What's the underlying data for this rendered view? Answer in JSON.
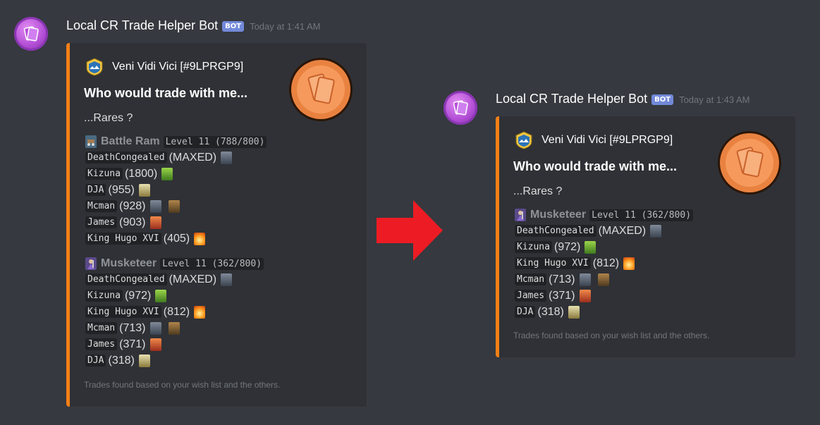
{
  "left": {
    "username": "Local CR Trade Helper Bot",
    "badge": "BOT",
    "timestamp": "Today at 1:41 AM",
    "embed": {
      "author": "Veni Vidi Vici [#9LPRGP9]",
      "title": "Who would trade with me...",
      "description": "...Rares ?",
      "fields": [
        {
          "card": "Battle Ram",
          "level": "Level 11 (788/800)",
          "rows": [
            {
              "player": "DeathCongealed",
              "count": "(MAXED)",
              "icons": [
                "knight-icon"
              ]
            },
            {
              "player": "Kizuna",
              "count": "(1800)",
              "icons": [
                "goblin-icon"
              ]
            },
            {
              "player": "DJA",
              "count": "(955)",
              "icons": [
                "spear-icon"
              ]
            },
            {
              "player": "Mcman",
              "count": "(928)",
              "icons": [
                "knight-icon",
                "hut-icon"
              ]
            },
            {
              "player": "James",
              "count": "(903)",
              "icons": [
                "valkyrie-icon"
              ]
            },
            {
              "player": "King Hugo XVI",
              "count": "(405)",
              "icons": [
                "fireball-icon"
              ]
            }
          ]
        },
        {
          "card": "Musketeer",
          "level": "Level 11 (362/800)",
          "rows": [
            {
              "player": "DeathCongealed",
              "count": "(MAXED)",
              "icons": [
                "knight-icon"
              ]
            },
            {
              "player": "Kizuna",
              "count": "(972)",
              "icons": [
                "goblin-icon"
              ]
            },
            {
              "player": "King Hugo XVI",
              "count": "(812)",
              "icons": [
                "fireball-icon"
              ]
            },
            {
              "player": "Mcman",
              "count": "(713)",
              "icons": [
                "knight-icon",
                "hut-icon"
              ]
            },
            {
              "player": "James",
              "count": "(371)",
              "icons": [
                "valkyrie-icon"
              ]
            },
            {
              "player": "DJA",
              "count": "(318)",
              "icons": [
                "spear-icon"
              ]
            }
          ]
        }
      ],
      "footer": "Trades found based on your wish list and the others."
    }
  },
  "right": {
    "username": "Local CR Trade Helper Bot",
    "badge": "BOT",
    "timestamp": "Today at 1:43 AM",
    "embed": {
      "author": "Veni Vidi Vici [#9LPRGP9]",
      "title": "Who would trade with me...",
      "description": "...Rares ?",
      "fields": [
        {
          "card": "Musketeer",
          "level": "Level 11 (362/800)",
          "rows": [
            {
              "player": "DeathCongealed",
              "count": "(MAXED)",
              "icons": [
                "knight-icon"
              ]
            },
            {
              "player": "Kizuna",
              "count": "(972)",
              "icons": [
                "goblin-icon"
              ]
            },
            {
              "player": "King Hugo XVI",
              "count": "(812)",
              "icons": [
                "fireball-icon"
              ]
            },
            {
              "player": "Mcman",
              "count": "(713)",
              "icons": [
                "knight-icon",
                "hut-icon"
              ]
            },
            {
              "player": "James",
              "count": "(371)",
              "icons": [
                "valkyrie-icon"
              ]
            },
            {
              "player": "DJA",
              "count": "(318)",
              "icons": [
                "spear-icon"
              ]
            }
          ]
        }
      ],
      "footer": "Trades found based on your wish list and the others."
    }
  },
  "colors": {
    "background": "#36393f",
    "embed": "#2f3136",
    "embed_accent": "#f57f17",
    "bot_badge": "#7289da",
    "arrow": "#ed1c24"
  }
}
